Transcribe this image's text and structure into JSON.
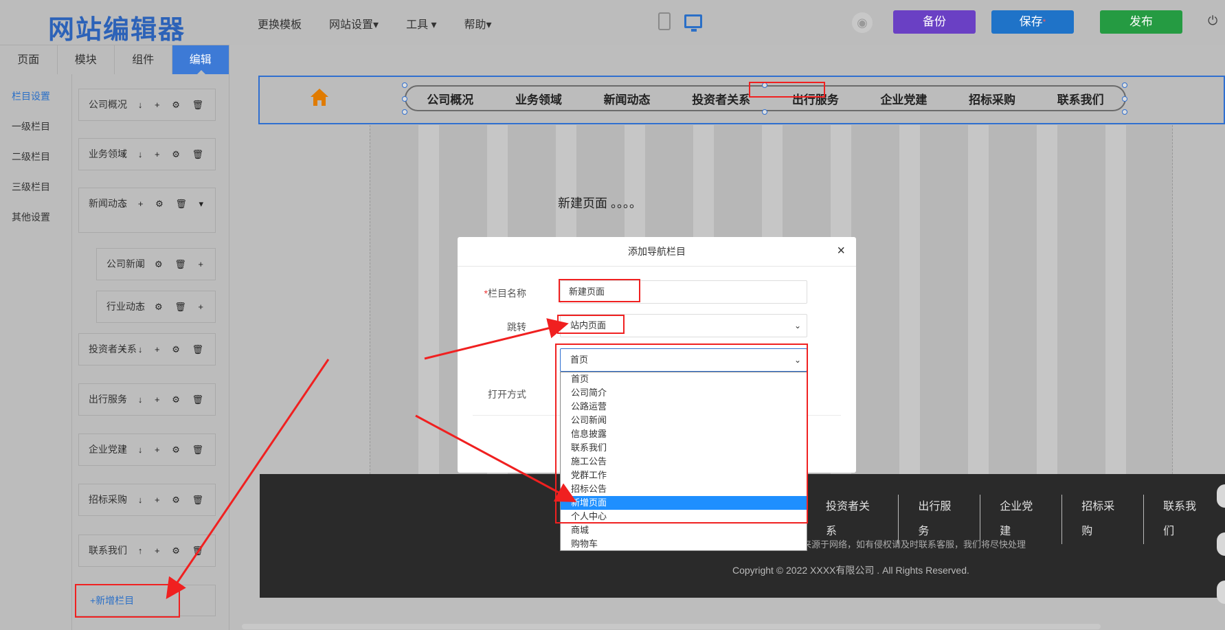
{
  "header": {
    "logo": "网站编辑器",
    "menu": [
      "更换模板",
      "网站设置▾",
      "工具 ▾",
      "帮助▾"
    ],
    "buttons": {
      "backup": "备份",
      "save": "保存",
      "save_star": "*",
      "publish": "发布"
    }
  },
  "tabs": [
    "页面",
    "模块",
    "组件",
    "编辑"
  ],
  "sidebar_nav": [
    "栏目设置",
    "一级栏目",
    "二级栏目",
    "三级栏目",
    "其他设置"
  ],
  "columns": [
    {
      "label": "公司概况",
      "actions": "↓ + ⚙ 🗑"
    },
    {
      "label": "业务领域",
      "actions": "↑ ↓ + ⚙ 🗑"
    },
    {
      "label": "新闻动态",
      "actions": "↓ + ⚙ 🗑 ▾"
    },
    {
      "label": "公司新闻",
      "actions": "↓ ⚙ 🗑 +"
    },
    {
      "label": "行业动态",
      "actions": "↑ ⚙ 🗑 +"
    },
    {
      "label": "投资者关系",
      "actions": "↑ ↓ + ⚙ 🗑"
    },
    {
      "label": "出行服务",
      "actions": "↑ ↓ + ⚙ 🗑"
    },
    {
      "label": "企业党建",
      "actions": "↑ ↓ + ⚙ 🗑"
    },
    {
      "label": "招标采购",
      "actions": "↑ ↓ + ⚙ 🗑"
    },
    {
      "label": "联系我们",
      "actions": "↑ + ⚙ 🗑"
    }
  ],
  "add_column": "+新增栏目",
  "site_nav": [
    "公司概况",
    "业务领域",
    "新闻动态",
    "投资者关系",
    "出行服务",
    "企业党建",
    "招标采购",
    "联系我们"
  ],
  "page_text": "新建页面 。。。。",
  "footer": {
    "nav": [
      "投资者关系",
      "出行服务",
      "企业党建",
      "招标采购",
      "联系我们"
    ],
    "note": "来源于网络，如有侵权请及时联系客服，我们将尽快处理",
    "copyright": "Copyright © 2022 XXXX有限公司 . All Rights Reserved."
  },
  "modal": {
    "title": "添加导航栏目",
    "close": "×",
    "name_label": "栏目名称",
    "name_required": "*",
    "name_value": "新建页面",
    "jump_label": "跳转",
    "jump_value": "站内页面",
    "open_label": "打开方式"
  },
  "page_select": {
    "value": "首页",
    "options": [
      "首页",
      "公司简介",
      "公路运营",
      "公司新闻",
      "信息披露",
      "联系我们",
      "施工公告",
      "党群工作",
      "招标公告",
      "新增页面",
      "个人中心",
      "商城",
      "购物车"
    ],
    "selected": "新增页面"
  },
  "colors": {
    "accent": "#3d7ad6",
    "backup": "#6a40c4",
    "save": "#1f73c8",
    "publish": "#259b42",
    "annotation": "#f02020"
  }
}
